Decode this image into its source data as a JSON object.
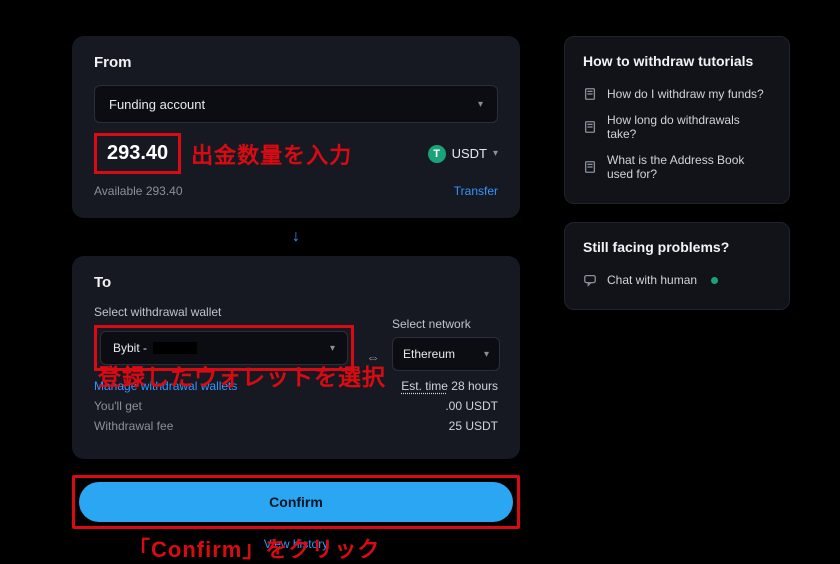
{
  "from": {
    "title": "From",
    "account_selected": "Funding account",
    "amount": "293.40",
    "currency": "USDT",
    "available_label": "Available",
    "available_value": "293.40",
    "transfer_link": "Transfer",
    "annotation": "出金数量を入力"
  },
  "arrow": "↓",
  "to": {
    "title": "To",
    "wallet_label": "Select withdrawal wallet",
    "wallet_value_prefix": "Bybit -",
    "network_label": "Select network",
    "network_value": "Ethereum",
    "manage_link": "Manage withdrawal wallets",
    "est_label": "Est. time",
    "est_value": "28 hours",
    "you_get_label": "You'll get",
    "you_get_value": ".00 USDT",
    "fee_label": "Withdrawal fee",
    "fee_value": "25 USDT",
    "annotation": "登録したウォレットを選択"
  },
  "confirm": {
    "label": "Confirm",
    "view_history": "View history",
    "annotation": "「Confirm」をクリック"
  },
  "side": {
    "tutorials_title": "How to withdraw tutorials",
    "tutorials": [
      "How do I withdraw my funds?",
      "How long do withdrawals take?",
      "What is the Address Book used for?"
    ],
    "problems_title": "Still facing problems?",
    "chat_label": "Chat with human"
  }
}
